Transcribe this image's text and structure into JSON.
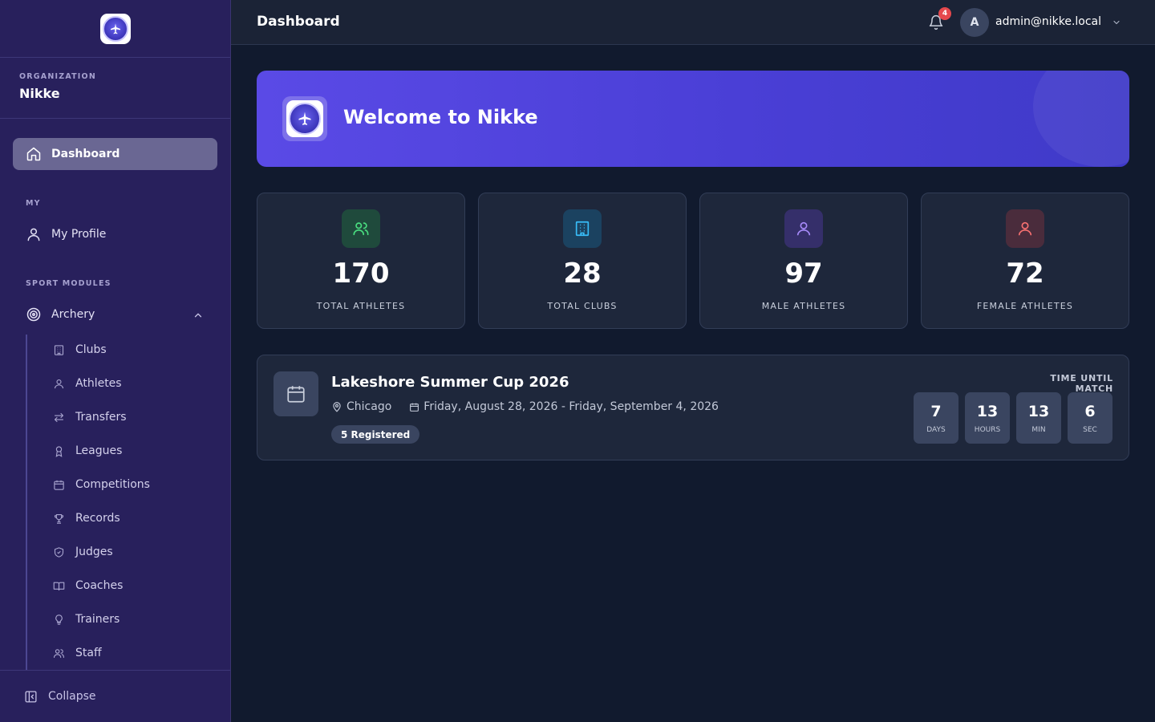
{
  "sidebar": {
    "organization_label": "ORGANIZATION",
    "organization_name": "Nikke",
    "dashboard_label": "Dashboard",
    "section_my": "MY",
    "my_profile_label": "My Profile",
    "section_sport_modules": "SPORT MODULES",
    "sport_label": "Archery",
    "sub_items": [
      {
        "label": "Clubs",
        "icon": "building-icon"
      },
      {
        "label": "Athletes",
        "icon": "user-icon"
      },
      {
        "label": "Transfers",
        "icon": "arrows-left-right-icon"
      },
      {
        "label": "Leagues",
        "icon": "award-icon"
      },
      {
        "label": "Competitions",
        "icon": "calendar-icon"
      },
      {
        "label": "Records",
        "icon": "trophy-icon"
      },
      {
        "label": "Judges",
        "icon": "shield-check-icon"
      },
      {
        "label": "Coaches",
        "icon": "book-open-icon"
      },
      {
        "label": "Trainers",
        "icon": "lightbulb-icon"
      },
      {
        "label": "Staff",
        "icon": "users-icon"
      }
    ],
    "collapse_label": "Collapse"
  },
  "header": {
    "page_title": "Dashboard",
    "notification_count": "4",
    "avatar_initial": "A",
    "user_email": "admin@nikke.local"
  },
  "welcome": {
    "title": "Welcome to Nikke"
  },
  "stats": [
    {
      "value": "170",
      "label": "TOTAL ATHLETES",
      "icon": "users-icon",
      "color": "#4ade80"
    },
    {
      "value": "28",
      "label": "TOTAL CLUBS",
      "icon": "building-icon",
      "color": "#38bdf8"
    },
    {
      "value": "97",
      "label": "MALE ATHLETES",
      "icon": "user-icon",
      "color": "#a78bfa"
    },
    {
      "value": "72",
      "label": "FEMALE ATHLETES",
      "icon": "user-icon",
      "color": "#f87171"
    }
  ],
  "event": {
    "title": "Lakeshore Summer Cup 2026",
    "location": "Chicago",
    "dates": "Friday, August 28, 2026 - Friday, September 4, 2026",
    "registered": "5 Registered",
    "countdown_label": "TIME UNTIL MATCH",
    "countdown": [
      {
        "value": "7",
        "unit": "DAYS"
      },
      {
        "value": "13",
        "unit": "HOURS"
      },
      {
        "value": "13",
        "unit": "MIN"
      },
      {
        "value": "6",
        "unit": "SEC"
      }
    ]
  },
  "colors": {
    "sidebar_bg": "#28205c",
    "main_bg": "#111a2e",
    "accent": "#5a4ae6",
    "badge": "#e5484d"
  }
}
